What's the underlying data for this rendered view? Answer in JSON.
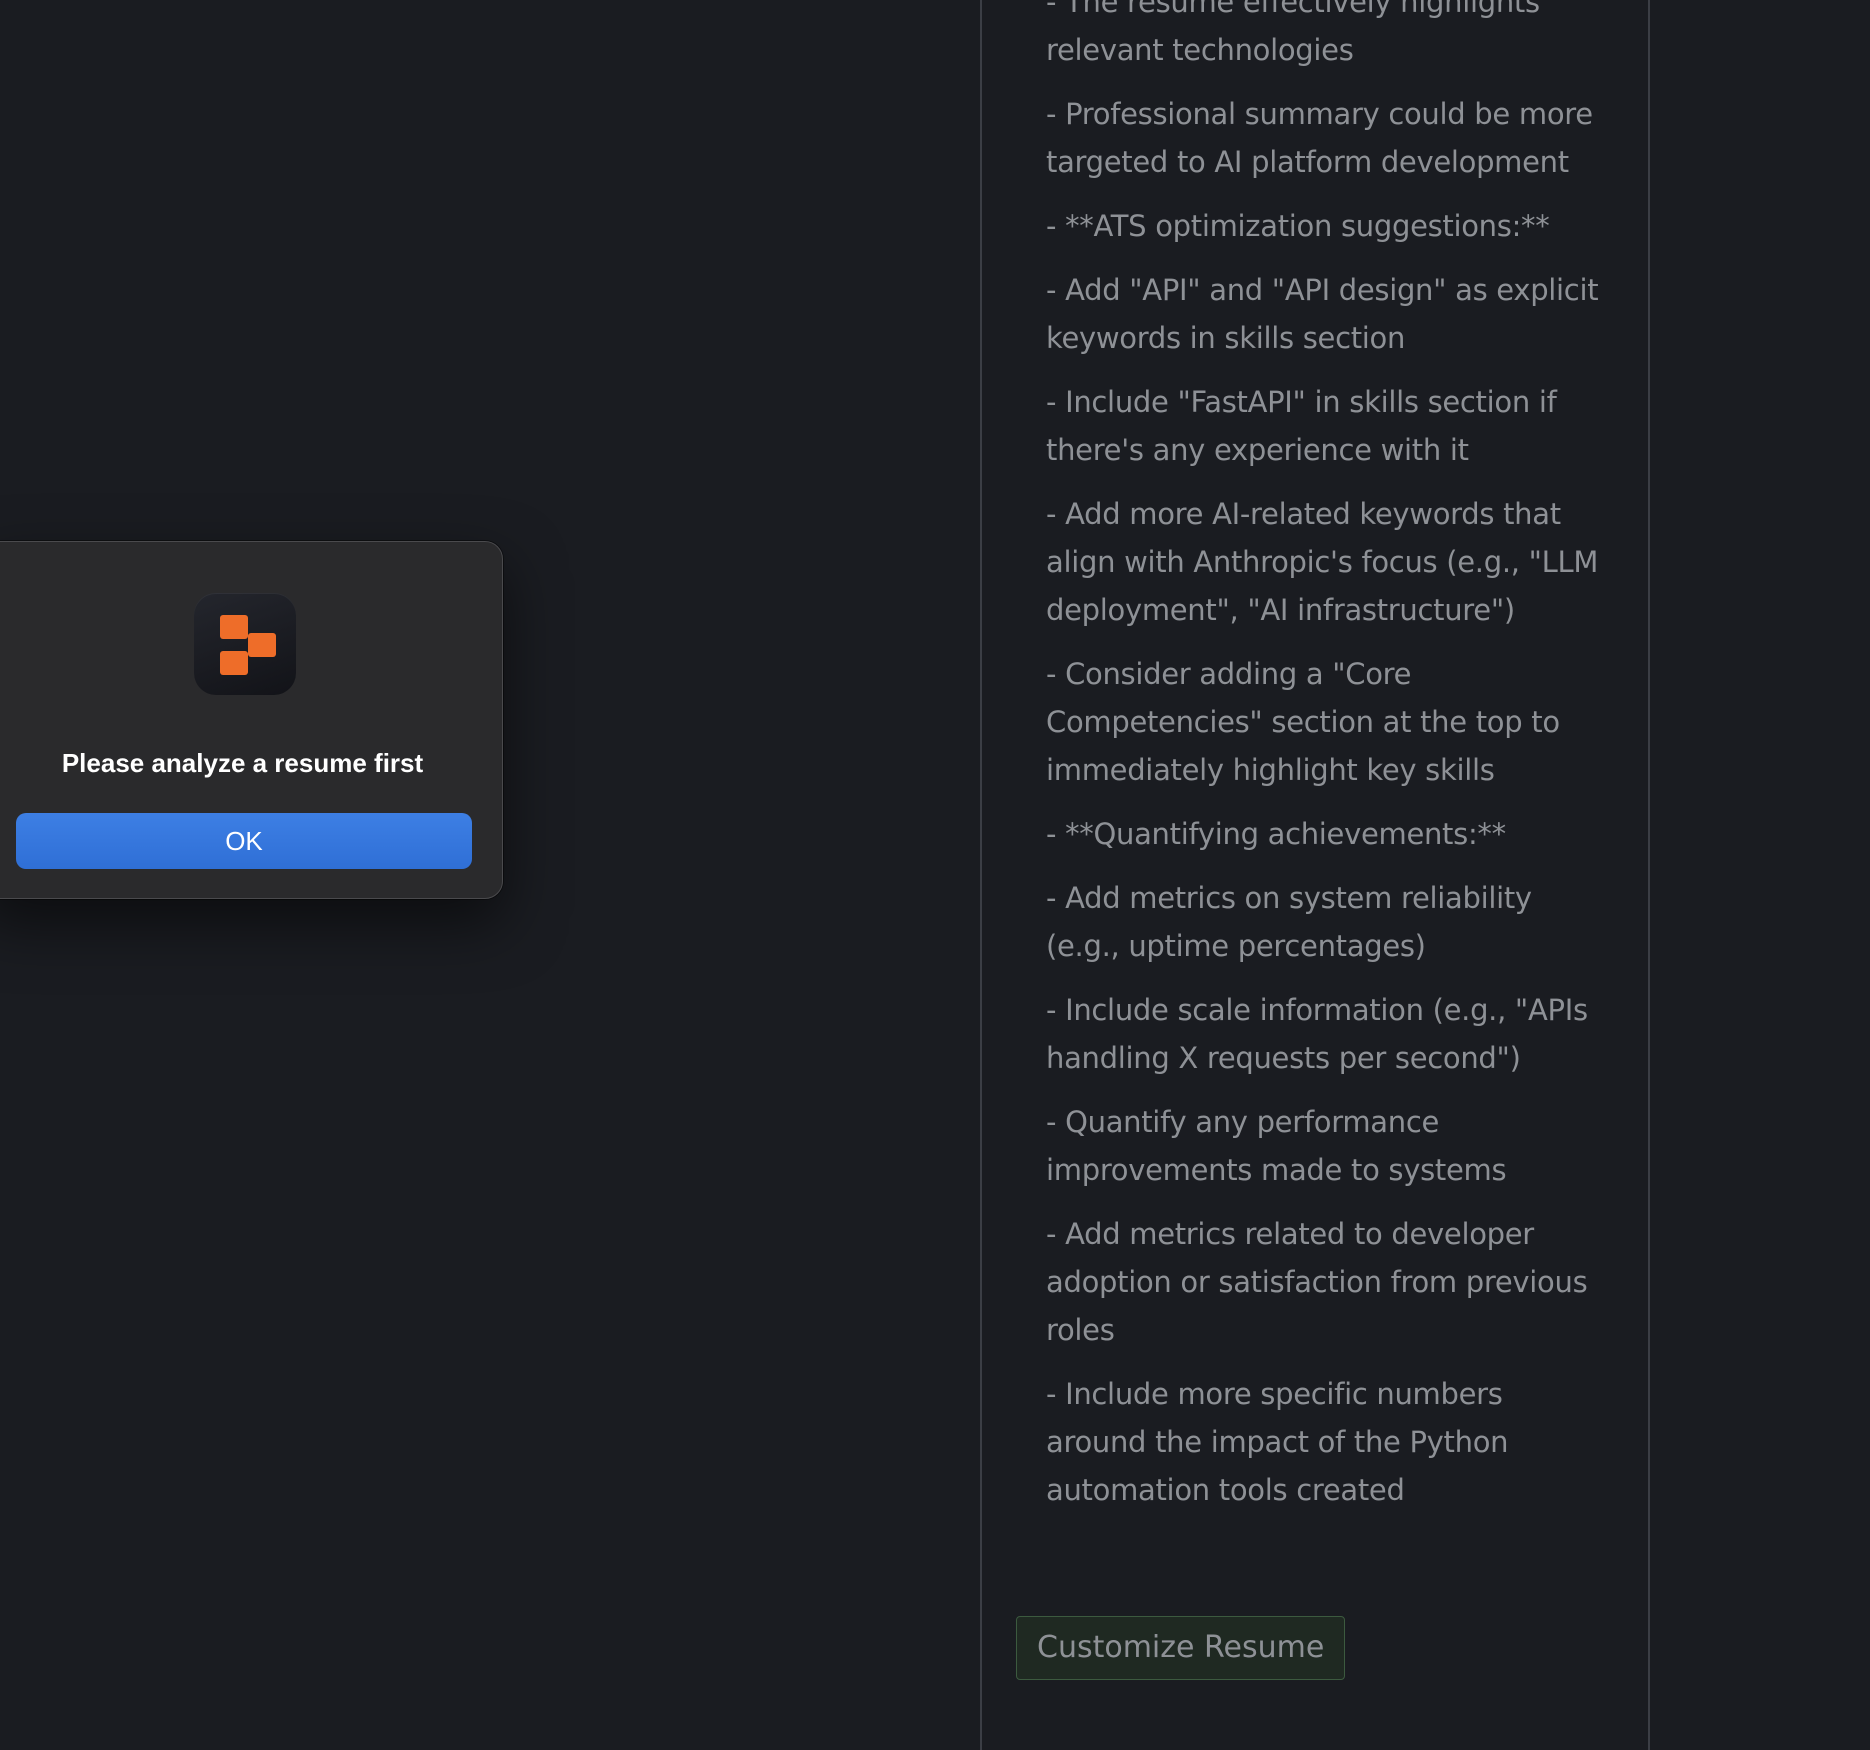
{
  "panel": {
    "feedback_items": [
      "- The resume effectively highlights relevant technologies",
      "- Professional summary could be more targeted to AI platform development",
      "- **ATS optimization suggestions:**",
      "- Add \"API\" and \"API design\" as explicit keywords in skills section",
      "- Include \"FastAPI\" in skills section if there's any experience with it",
      "- Add more AI-related keywords that align with Anthropic's focus (e.g., \"LLM deployment\", \"AI infrastructure\")",
      "- Consider adding a \"Core Competencies\" section at the top to immediately highlight key skills",
      "- **Quantifying achievements:**",
      "- Add metrics on system reliability (e.g., uptime percentages)",
      "- Include scale information (e.g., \"APIs handling X requests per second\")",
      "- Quantify any performance improvements made to systems",
      "- Add metrics related to developer adoption or satisfaction from previous roles",
      "- Include more specific numbers around the impact of the Python automation tools created"
    ],
    "customize_button_label": "Customize Resume"
  },
  "dialog": {
    "message": "Please analyze a resume first",
    "ok_label": "OK",
    "app_icon": "app-logo-icon",
    "icon_color": "#ee6d29",
    "button_color": "#3b7ae0"
  },
  "colors": {
    "background": "#1a1c21",
    "text": "#8e9196",
    "panel_border": "#3b3e45",
    "button_border": "#3c5a3f"
  }
}
